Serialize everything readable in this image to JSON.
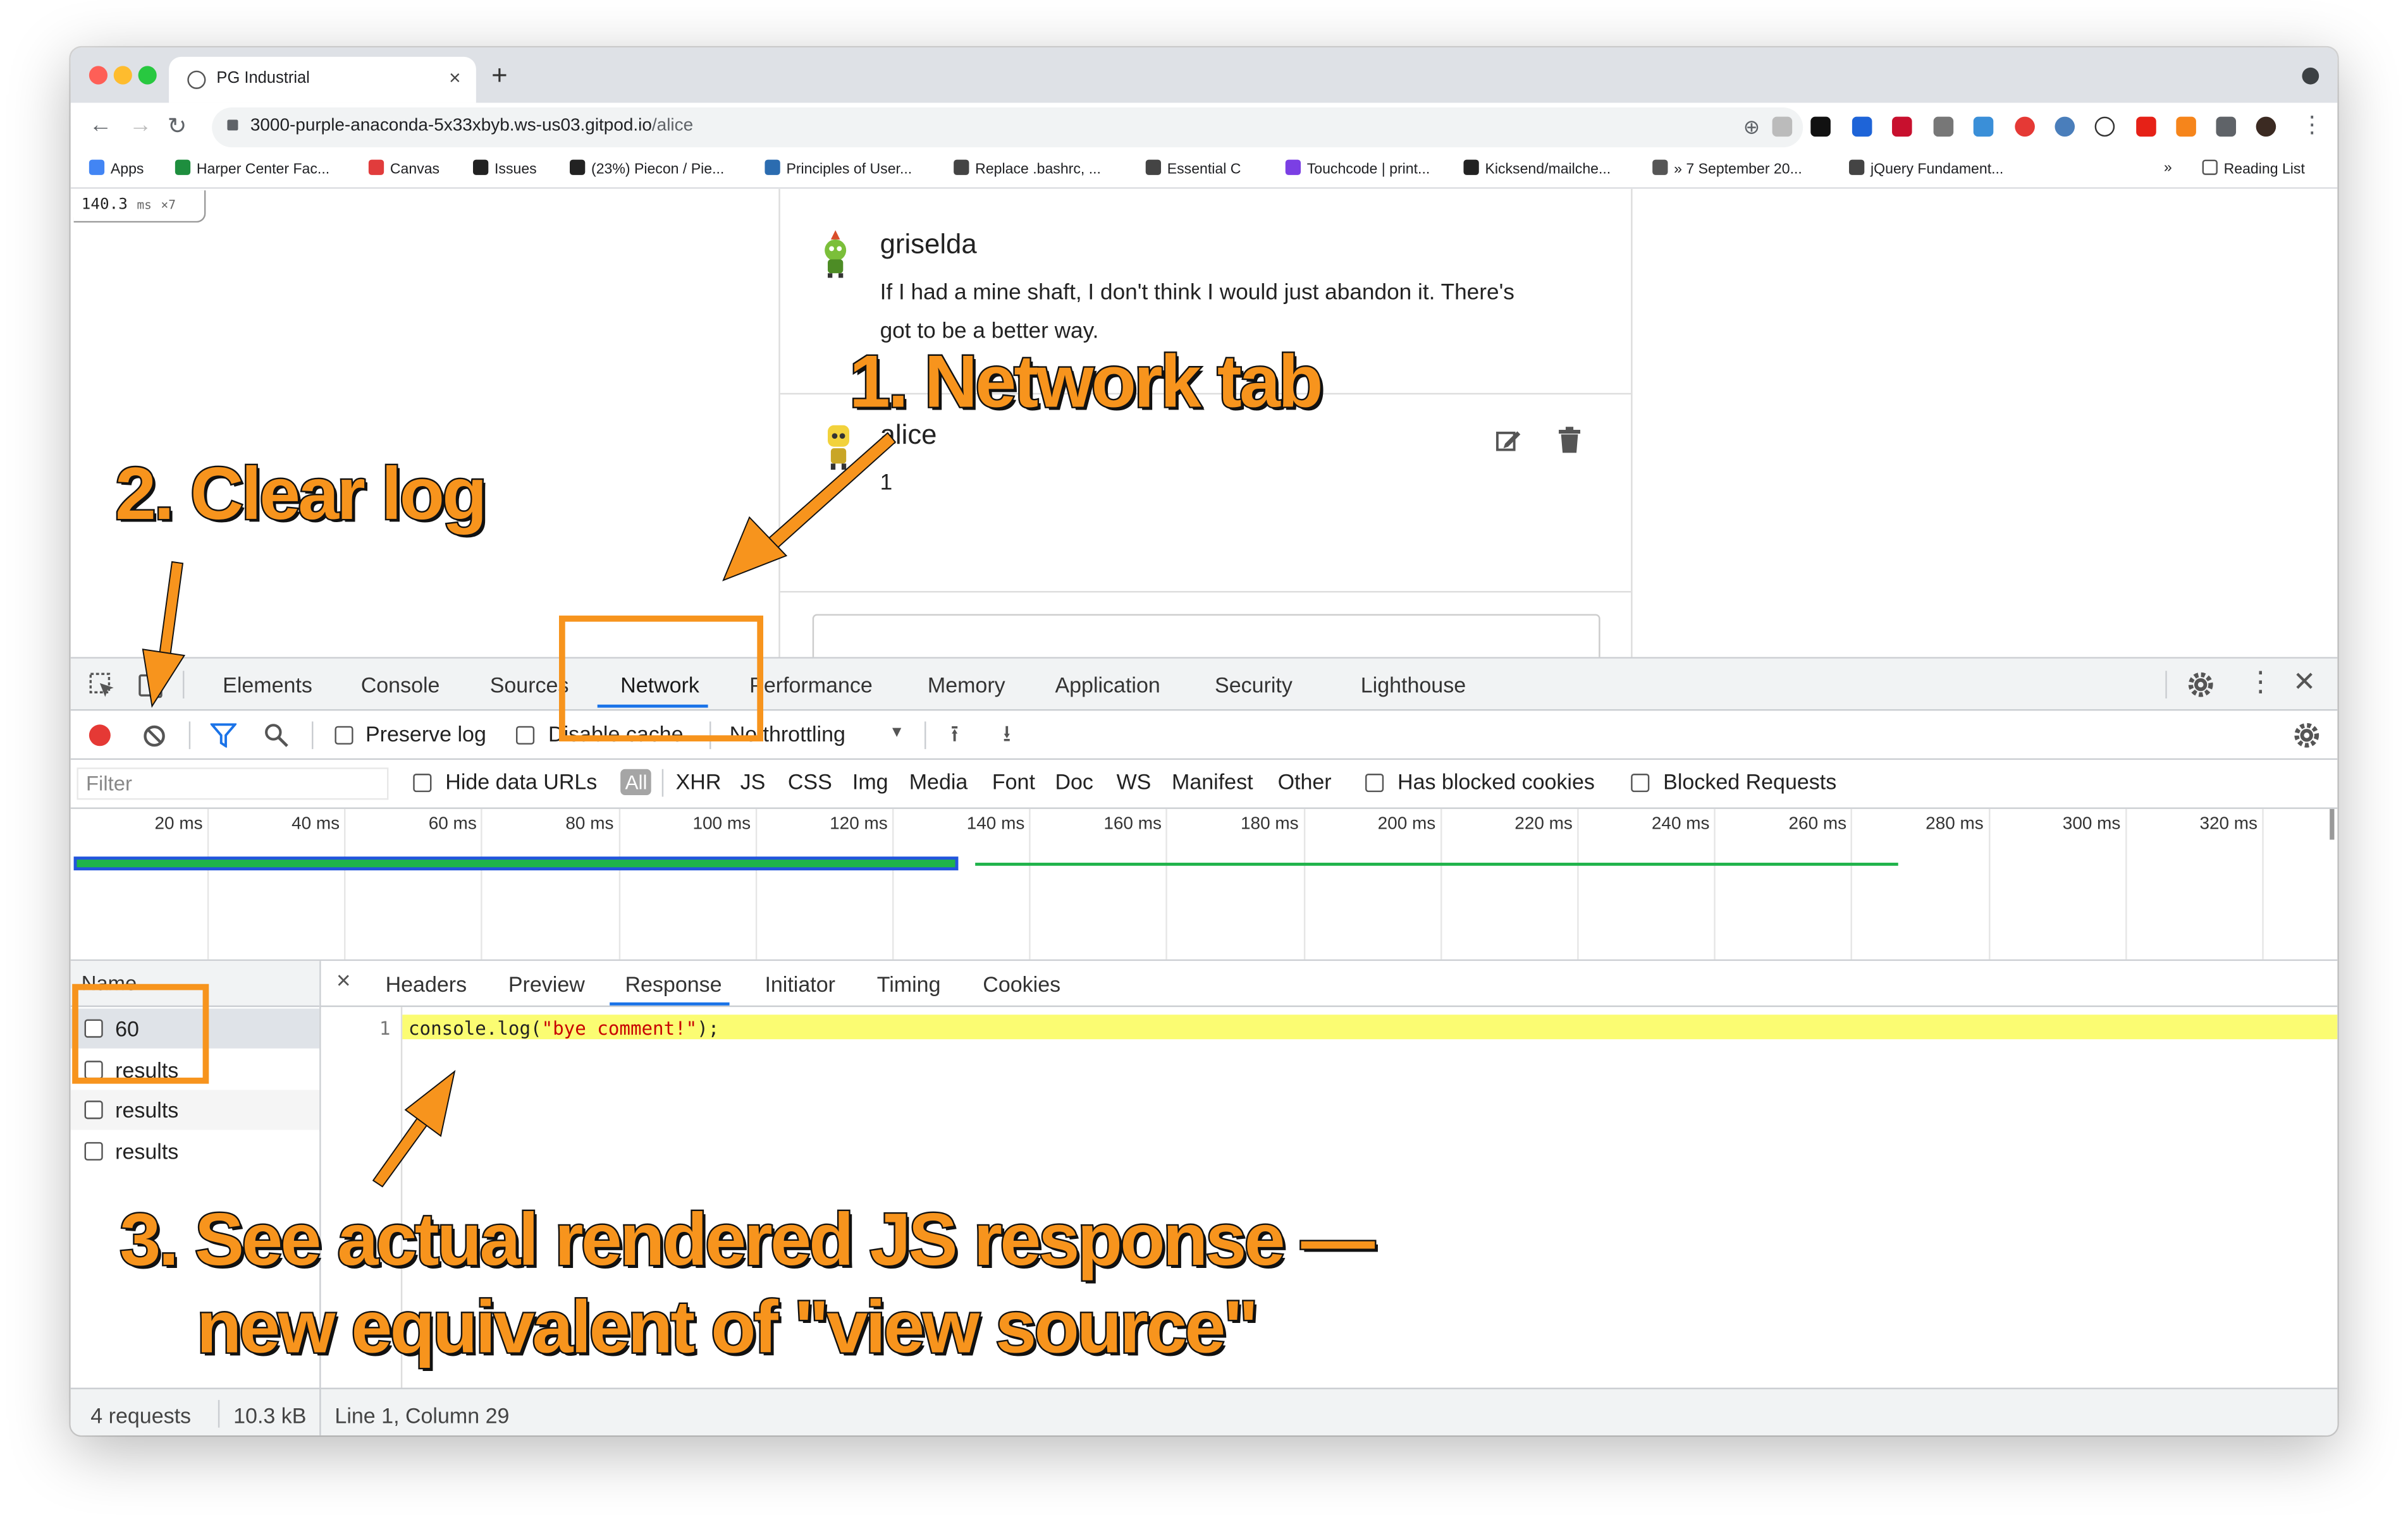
{
  "browser": {
    "tab_title": "PG Industrial",
    "tab_close": "×",
    "new_tab": "+",
    "url_host": "3000-purple-anaconda-5x33xbyb.ws-us03.gitpod.io",
    "url_path": "/alice",
    "bookmarks_overflow": "»",
    "bookmarks": [
      {
        "label": "Apps",
        "icon": "apps-grid-icon",
        "color": "#4285f4"
      },
      {
        "label": "Harper Center Fac...",
        "icon": "plus-cross-icon",
        "color": "#1e8e3e"
      },
      {
        "label": "Canvas",
        "icon": "canvas-icon",
        "color": "#e13c3c"
      },
      {
        "label": "Issues",
        "icon": "github-icon",
        "color": "#222222"
      },
      {
        "label": "(23%) Piecon / Pie...",
        "icon": "github-icon",
        "color": "#222222"
      },
      {
        "label": "Principles of User...",
        "icon": "b-icon",
        "color": "#2b6cb0"
      },
      {
        "label": "Replace .bashrc, ...",
        "icon": "globe-icon",
        "color": "#444444"
      },
      {
        "label": "Essential C",
        "icon": "globe-icon",
        "color": "#444444"
      },
      {
        "label": "Touchcode | print...",
        "icon": "touchcode-icon",
        "color": "#7b3fe4"
      },
      {
        "label": "Kicksend/mailche...",
        "icon": "github-icon",
        "color": "#222222"
      },
      {
        "label": "» 7 September 20...",
        "icon": "p-icon",
        "color": "#555555"
      },
      {
        "label": "jQuery Fundament...",
        "icon": "jquery-icon",
        "color": "#444444"
      }
    ],
    "reading_list": "Reading List"
  },
  "page": {
    "fps_value": "140.3",
    "fps_unit": "ms",
    "fps_count": "×7",
    "comments": [
      {
        "user": "griselda",
        "text_line1": "If I had a mine shaft, I don't think I would just abandon it. There's",
        "text_line2": "got to be a better way."
      },
      {
        "user": "alice",
        "text_line1": "1",
        "text_line2": ""
      }
    ]
  },
  "devtools": {
    "tabs": [
      "Elements",
      "Console",
      "Sources",
      "Network",
      "Performance",
      "Memory",
      "Application",
      "Security",
      "Lighthouse"
    ],
    "active_tab": "Network",
    "preserve_log": "Preserve log",
    "disable_cache": "Disable cache",
    "throttling": "No throttling",
    "filter_placeholder": "Filter",
    "hide_data_urls": "Hide data URLs",
    "types": [
      "All",
      "XHR",
      "JS",
      "CSS",
      "Img",
      "Media",
      "Font",
      "Doc",
      "WS",
      "Manifest",
      "Other"
    ],
    "has_blocked_cookies": "Has blocked cookies",
    "blocked_requests": "Blocked Requests",
    "timeline_ticks": [
      "20 ms",
      "40 ms",
      "60 ms",
      "80 ms",
      "100 ms",
      "120 ms",
      "140 ms",
      "160 ms",
      "180 ms",
      "200 ms",
      "220 ms",
      "240 ms",
      "260 ms",
      "280 ms",
      "300 ms",
      "320 ms"
    ],
    "name_header": "Name",
    "requests": [
      "60",
      "results",
      "results",
      "results"
    ],
    "detail_close": "×",
    "detail_tabs": [
      "Headers",
      "Preview",
      "Response",
      "Initiator",
      "Timing",
      "Cookies"
    ],
    "active_detail_tab": "Response",
    "line_number": "1",
    "code_prefix": "console.log(",
    "code_string": "\"bye comment!\"",
    "code_suffix": ");",
    "status_requests": "4 requests",
    "status_size": "10.3 kB",
    "status_cursor": "Line 1, Column 29"
  },
  "annotations": {
    "step1": "1. Network tab",
    "step2": "2. Clear log",
    "step3_line1": "3. See actual rendered JS response —",
    "step3_line2": "new equivalent of \"view source\""
  },
  "colors": {
    "annotation_orange": "#f7941d",
    "record_red": "#e53935",
    "accent_blue": "#1a73e8",
    "bar_green": "#1fb34a",
    "bar_blue": "#2255dd"
  }
}
